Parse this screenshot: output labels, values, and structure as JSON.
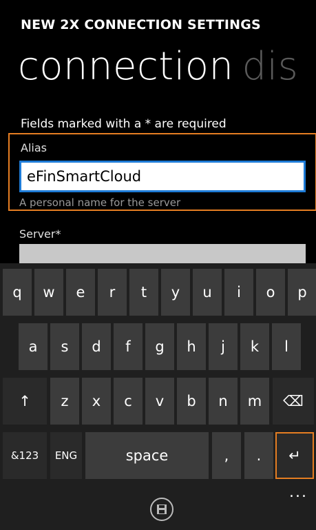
{
  "header": {
    "app_title": "NEW 2X CONNECTION SETTINGS",
    "pivot_active": "connection",
    "pivot_next": "dis"
  },
  "form": {
    "required_note": "Fields marked with a * are required",
    "alias": {
      "label": "Alias",
      "value": "eFinSmartCloud",
      "hint": "A personal name for the server"
    },
    "server": {
      "label": "Server*",
      "value": ""
    }
  },
  "keyboard": {
    "row1": [
      "q",
      "w",
      "e",
      "r",
      "t",
      "y",
      "u",
      "i",
      "o",
      "p"
    ],
    "row2": [
      "a",
      "s",
      "d",
      "f",
      "g",
      "h",
      "j",
      "k",
      "l"
    ],
    "row3_letters": [
      "z",
      "x",
      "c",
      "v",
      "b",
      "n",
      "m"
    ],
    "shift_icon": "↑",
    "backspace_icon": "⌫",
    "symbols_label": "&123",
    "language_label": "ENG",
    "space_label": "space",
    "comma_label": ",",
    "period_label": ".",
    "enter_icon": "↵"
  },
  "appbar": {
    "save_icon": "floppy-disk-icon",
    "more_label": "..."
  },
  "colors": {
    "accent_orange": "#e67e22",
    "input_focus_blue": "#1e7bd6"
  }
}
